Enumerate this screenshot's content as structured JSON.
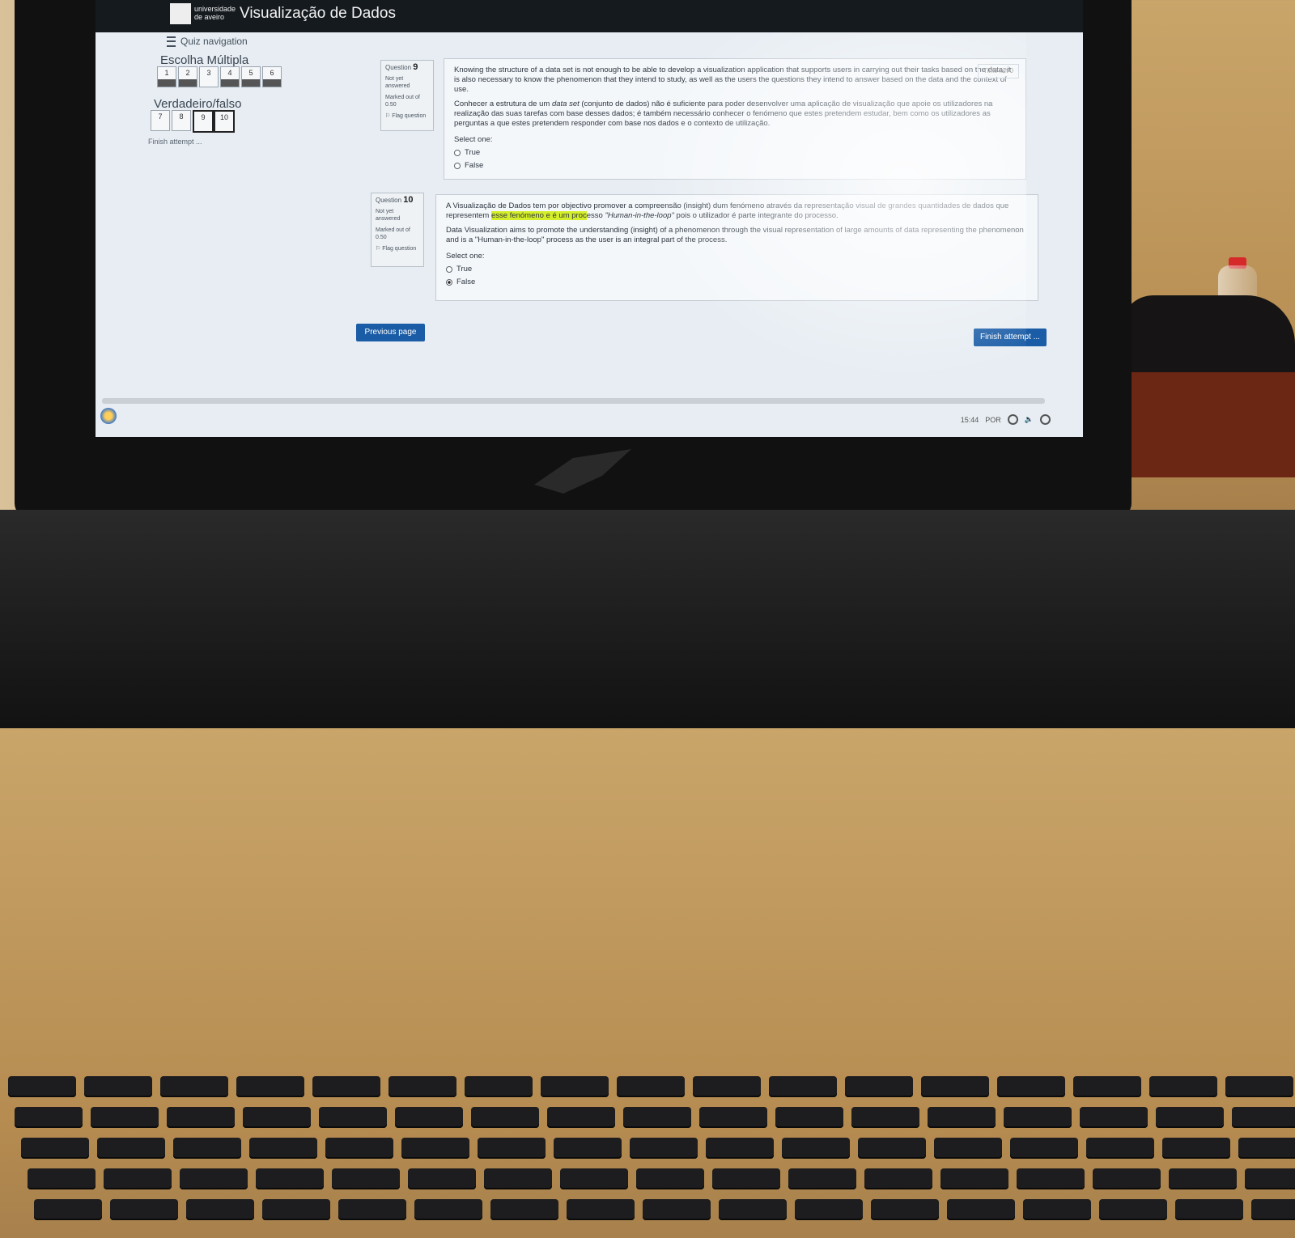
{
  "header": {
    "university": "universidade de aveiro",
    "title": "Visualização de Dados"
  },
  "nav": {
    "title": "Quiz navigation",
    "section1": "Escolha Múltipla",
    "section1_items": [
      "1",
      "2",
      "3",
      "4",
      "5",
      "6"
    ],
    "section2": "Verdadeiro/falso",
    "section2_items": [
      "7",
      "8",
      "9",
      "10"
    ],
    "finish": "Finish attempt ..."
  },
  "timer": "Time left 0",
  "q9": {
    "label": "Question",
    "number": "9",
    "status": "Not yet answered",
    "marked": "Marked out of 0.50",
    "flag": "Flag question",
    "en": "Knowing the structure of a data set is not enough to be able to develop a visualization application that supports users in carrying out their tasks based on the data; it is also necessary to know the phenomenon that they intend to study, as well as the users the questions they intend to answer based on the data and the context of use.",
    "pt_1": "Conhecer a estrutura de um ",
    "pt_italic": "data set",
    "pt_2": " (conjunto de dados) não é suficiente para poder desenvolver uma aplicação de visualização que apoie os utilizadores na realização das suas tarefas com base desses dados; é também necessário conhecer o fenómeno que estes pretendem estudar, bem como os utilizadores as perguntas a que estes pretendem responder com base nos dados e o contexto de utilização.",
    "select": "Select one:",
    "opt_true": "True",
    "opt_false": "False"
  },
  "q10": {
    "label": "Question",
    "number": "10",
    "status": "Not yet answered",
    "marked": "Marked out of 0.50",
    "flag": "Flag question",
    "pt_1": "A Visualização de Dados tem por objectivo promover a compreensão (insight) dum fenómeno através da representação visual de grandes quantidades de dados que representem ",
    "pt_hl": "esse fenómeno e é um proc",
    "pt_2": "esso ",
    "pt_italic": "\"Human-in-the-loop\"",
    "pt_3": " pois o utilizador é parte integrante do processo.",
    "en": "Data Visualization aims to promote the understanding (insight) of a phenomenon through the visual representation of large amounts of data representing the phenomenon and is a \"Human-in-the-loop\" process as the user is an integral part of the process.",
    "select": "Select one:",
    "opt_true": "True",
    "opt_false": "False",
    "selected": "False"
  },
  "buttons": {
    "previous": "Previous page",
    "finish": "Finish attempt ..."
  },
  "tray": {
    "time": "15:44",
    "lang": "POR"
  },
  "icons": [
    "menu-icon",
    "flag-icon",
    "radio-icon",
    "refresh-icon",
    "volume-icon",
    "power-icon",
    "university-logo"
  ]
}
